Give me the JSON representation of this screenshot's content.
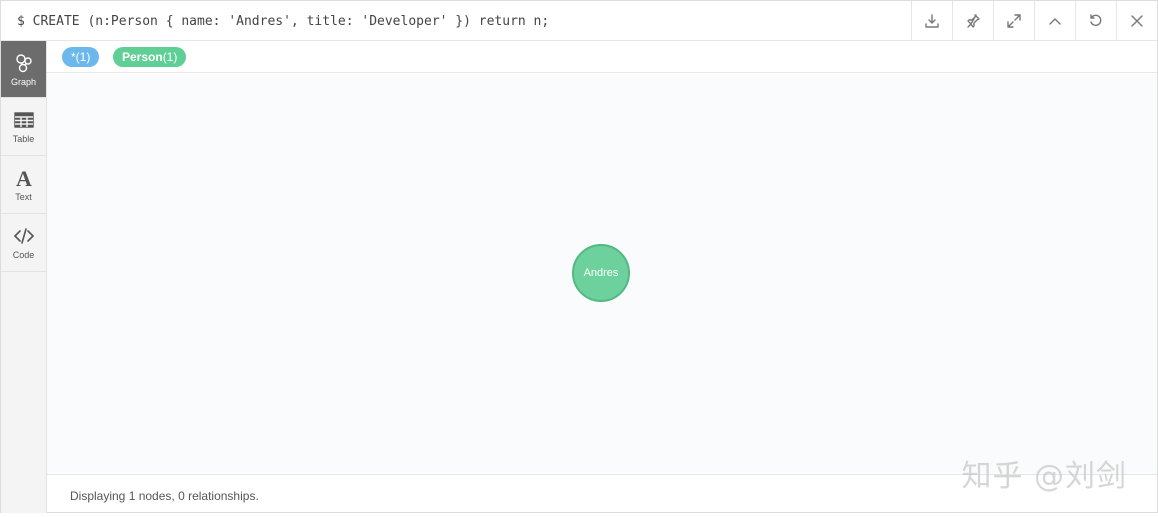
{
  "header": {
    "query": "$ CREATE (n:Person { name: 'Andres', title: 'Developer' }) return n;",
    "actions": [
      {
        "name": "download",
        "icon": "download-icon"
      },
      {
        "name": "pin",
        "icon": "pin-icon"
      },
      {
        "name": "expand",
        "icon": "expand-icon"
      },
      {
        "name": "collapse",
        "icon": "chevron-up-icon"
      },
      {
        "name": "rerun",
        "icon": "rerun-icon"
      },
      {
        "name": "close",
        "icon": "close-icon"
      }
    ]
  },
  "sidebar": {
    "items": [
      {
        "label": "Graph",
        "icon": "graph-icon",
        "active": true
      },
      {
        "label": "Table",
        "icon": "table-icon",
        "active": false
      },
      {
        "label": "Text",
        "icon": "text-icon",
        "active": false
      },
      {
        "label": "Code",
        "icon": "code-icon",
        "active": false
      }
    ]
  },
  "tags": {
    "all": "*(1)",
    "person_name": "Person",
    "person_count": "(1)"
  },
  "graph": {
    "node_label": "Andres",
    "node_color": "#6dd19d",
    "node_border": "#53b882"
  },
  "colors": {
    "tag_all": "#6cb8ec",
    "tag_person": "#5fcf95",
    "sidebar_active": "#6c6c6c"
  },
  "footer": {
    "status": "Displaying 1 nodes, 0 relationships."
  },
  "watermark": "知乎 @刘剑"
}
